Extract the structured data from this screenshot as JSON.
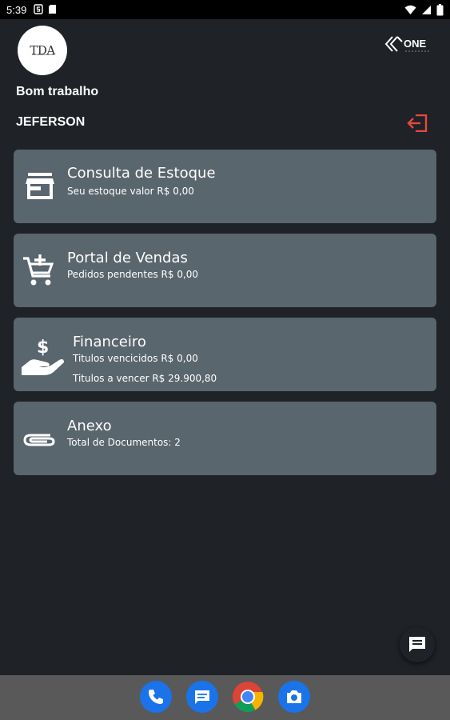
{
  "status_bar": {
    "time": "5:39"
  },
  "header": {
    "logo_text": "TDA",
    "brand": "ONE",
    "greeting": "Bom trabalho",
    "user_name": "JEFERSON"
  },
  "cards": [
    {
      "icon": "store-icon",
      "title": "Consulta de Estoque",
      "lines": [
        "Seu estoque valor R$ 0,00"
      ]
    },
    {
      "icon": "add-cart-icon",
      "title": "Portal de Vendas",
      "lines": [
        "Pedidos  pendentes R$ 0,00"
      ]
    },
    {
      "icon": "hand-money-icon",
      "title": "Financeiro",
      "lines": [
        "Titulos vencicidos R$ 0,00",
        "Titulos a vencer R$ 29.900,80"
      ]
    },
    {
      "icon": "paperclip-icon",
      "title": "Anexo",
      "lines": [
        "Total de Documentos: 2"
      ]
    }
  ],
  "dock": [
    "phone-icon",
    "messages-icon",
    "chrome-icon",
    "camera-icon"
  ],
  "colors": {
    "background": "#1f2226",
    "card": "#5a666e",
    "logout": "#e5483f",
    "nav_bar": "#595959"
  }
}
